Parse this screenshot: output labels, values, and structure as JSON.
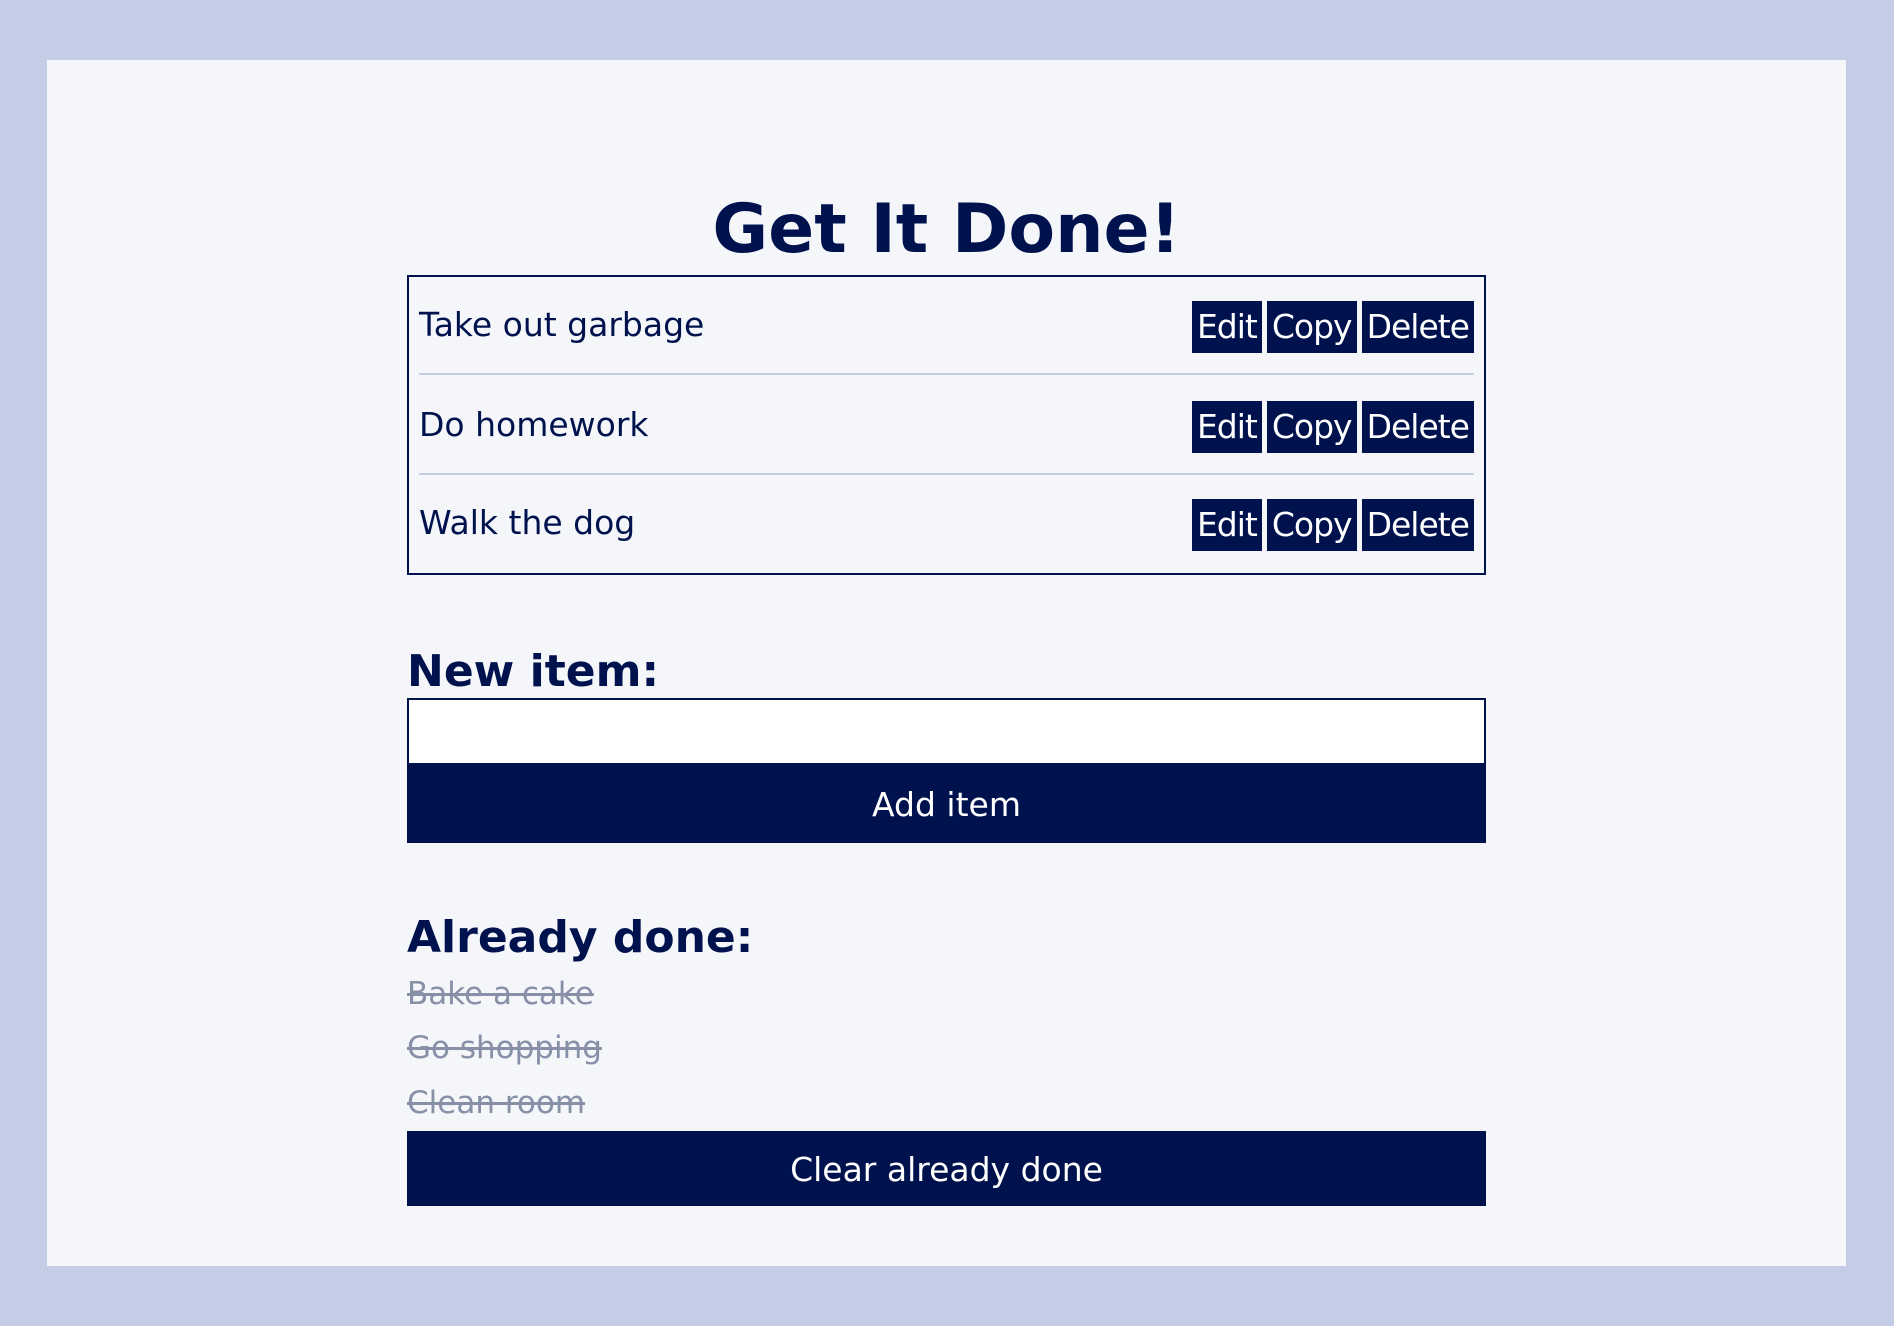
{
  "app": {
    "title": "Get It Done!"
  },
  "todo_list": {
    "items": [
      {
        "label": "Take out garbage",
        "edit_label": "Edit",
        "copy_label": "Copy",
        "delete_label": "Delete"
      },
      {
        "label": "Do homework",
        "edit_label": "Edit",
        "copy_label": "Copy",
        "delete_label": "Delete"
      },
      {
        "label": "Walk the dog",
        "edit_label": "Edit",
        "copy_label": "Copy",
        "delete_label": "Delete"
      }
    ]
  },
  "new_item": {
    "heading": "New item:",
    "input_value": "",
    "input_placeholder": "",
    "add_button_label": "Add item"
  },
  "done": {
    "heading": "Already done:",
    "items": [
      "Bake a cake",
      "Go shopping",
      "Clean room"
    ],
    "clear_button_label": "Clear already done"
  },
  "colors": {
    "background": "#c5cce6",
    "card": "#f4f6fa",
    "primary": "#00124d",
    "done_text": "#8890a8",
    "divider": "#c5cce6"
  }
}
